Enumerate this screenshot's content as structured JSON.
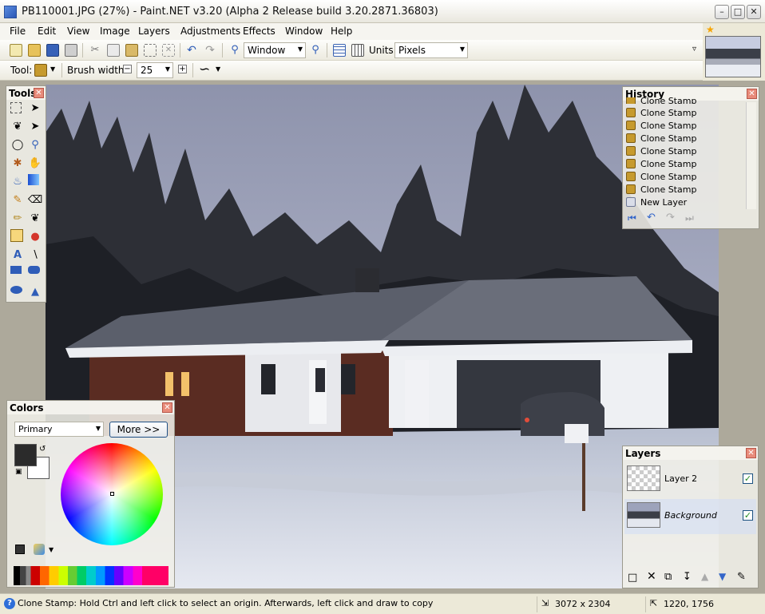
{
  "window": {
    "title": "PB110001.JPG (27%) - Paint.NET v3.20 (Alpha 2 Release build 3.20.2871.36803)"
  },
  "menu": [
    "File",
    "Edit",
    "View",
    "Image",
    "Layers",
    "Adjustments",
    "Effects",
    "Window",
    "Help"
  ],
  "toolbar": {
    "zoom_value": "Window",
    "units_label": "Units:",
    "units_value": "Pixels",
    "tool_label": "Tool:",
    "brush_width_label": "Brush width:",
    "brush_width_value": "25"
  },
  "tools_panel": {
    "title": "Tools"
  },
  "history_panel": {
    "title": "History",
    "items": [
      "Clone Stamp",
      "Clone Stamp",
      "Clone Stamp",
      "Clone Stamp",
      "Clone Stamp",
      "Clone Stamp",
      "Clone Stamp",
      "Clone Stamp",
      "New Layer"
    ]
  },
  "colors_panel": {
    "title": "Colors",
    "mode_value": "Primary",
    "more_label": "More >>"
  },
  "layers_panel": {
    "title": "Layers",
    "layers": [
      {
        "name": "Layer 2",
        "visible": true
      },
      {
        "name": "Background",
        "visible": true
      }
    ]
  },
  "statusbar": {
    "text": "Clone Stamp: Hold Ctrl and left click to select an origin. Afterwards, left click and draw to copy",
    "image_size": "3072 x 2304",
    "cursor_position": "1220, 1756"
  },
  "colors": {
    "primary": "#2b2b2b",
    "secondary": "#ffffff",
    "titlebar_accent": "#ece9d8"
  }
}
